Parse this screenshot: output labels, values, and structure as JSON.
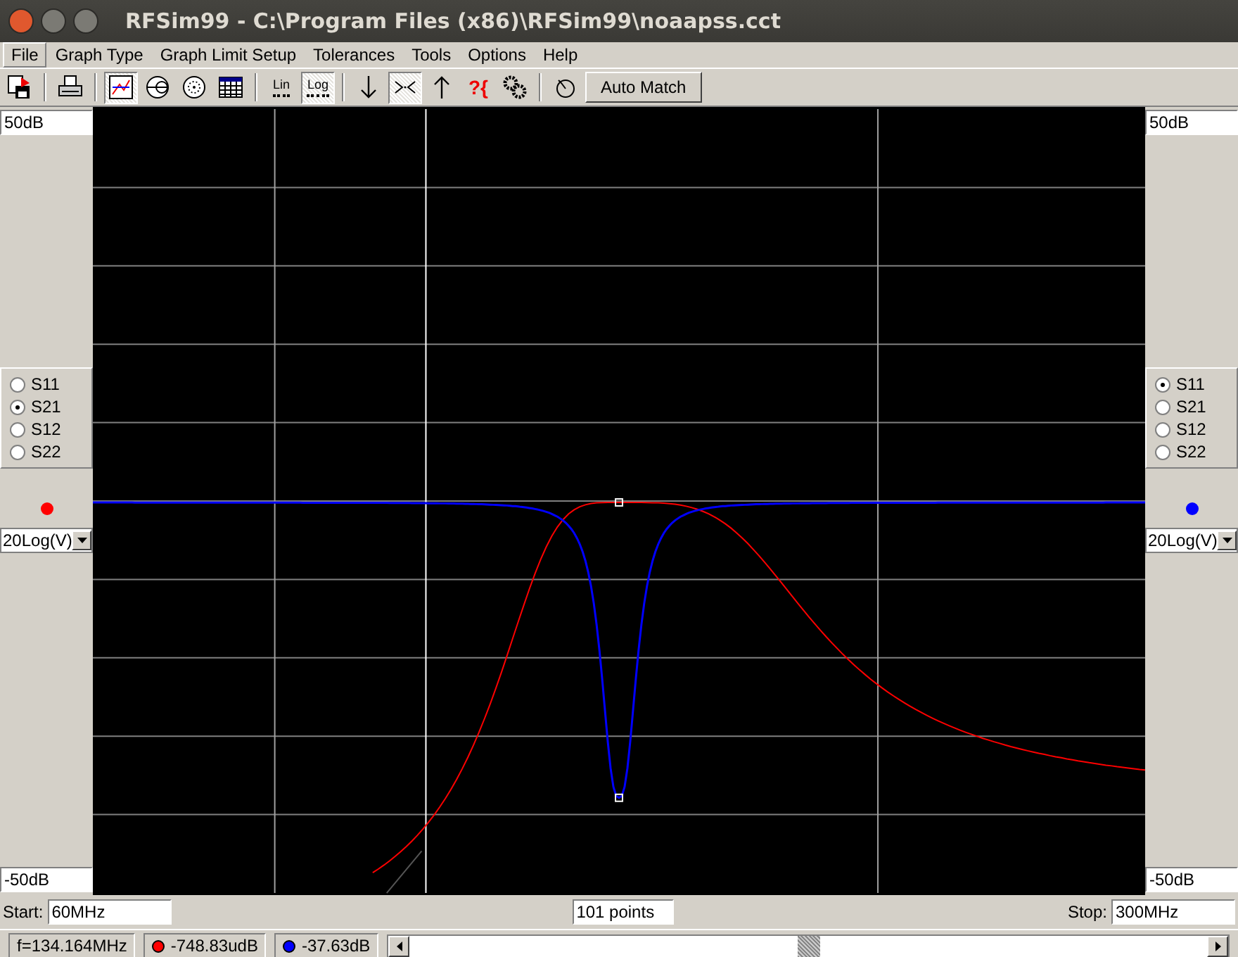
{
  "window": {
    "title": "RFSim99 - C:\\Program Files (x86)\\RFSim99\\noaapss.cct"
  },
  "menu": [
    {
      "label": "File",
      "selected": true
    },
    {
      "label": "Graph Type",
      "selected": false
    },
    {
      "label": "Graph Limit Setup",
      "selected": false
    },
    {
      "label": "Tolerances",
      "selected": false
    },
    {
      "label": "Tools",
      "selected": false
    },
    {
      "label": "Options",
      "selected": false
    },
    {
      "label": "Help",
      "selected": false
    }
  ],
  "toolbar": [
    {
      "kind": "button",
      "pressed": false
    },
    {
      "kind": "separator"
    },
    {
      "kind": "button",
      "pressed": false
    },
    {
      "kind": "separator"
    },
    {
      "kind": "button",
      "pressed": true
    },
    {
      "kind": "button",
      "pressed": false
    },
    {
      "kind": "button",
      "pressed": false
    },
    {
      "kind": "button",
      "pressed": false
    },
    {
      "kind": "separator"
    },
    {
      "kind": "button",
      "label": "Lin",
      "pressed": false
    },
    {
      "kind": "button",
      "label": "Log",
      "pressed": true
    },
    {
      "kind": "separator"
    },
    {
      "kind": "button",
      "pressed": false
    },
    {
      "kind": "button",
      "pressed": true
    },
    {
      "kind": "button",
      "pressed": false
    },
    {
      "kind": "button",
      "label": "?{",
      "pressed": false
    },
    {
      "kind": "button",
      "pressed": false
    },
    {
      "kind": "separator"
    },
    {
      "kind": "button",
      "pressed": false
    },
    {
      "kind": "text",
      "label": "Auto Match"
    }
  ],
  "left_panel": {
    "top_limit": "50dB",
    "params": [
      {
        "label": "S11",
        "selected": false
      },
      {
        "label": "S21",
        "selected": true
      },
      {
        "label": "S12",
        "selected": false
      },
      {
        "label": "S22",
        "selected": false
      }
    ],
    "color": "#ff0000",
    "scale": "20Log(V)",
    "bottom_limit": "-50dB"
  },
  "right_panel": {
    "top_limit": "50dB",
    "params": [
      {
        "label": "S11",
        "selected": true
      },
      {
        "label": "S21",
        "selected": false
      },
      {
        "label": "S12",
        "selected": false
      },
      {
        "label": "S22",
        "selected": false
      }
    ],
    "color": "#0000ff",
    "scale": "20Log(V)",
    "bottom_limit": "-50dB"
  },
  "sweep": {
    "start_label": "Start:",
    "start": "60MHz",
    "points": "101 points",
    "stop_label": "Stop:",
    "stop": "300MHz"
  },
  "status_bar": {
    "frequency": "f=134.164MHz",
    "readings": [
      {
        "color": "#ff0000",
        "value": "-748.83udB"
      },
      {
        "color": "#0000ff",
        "value": "-37.63dB"
      }
    ]
  }
}
